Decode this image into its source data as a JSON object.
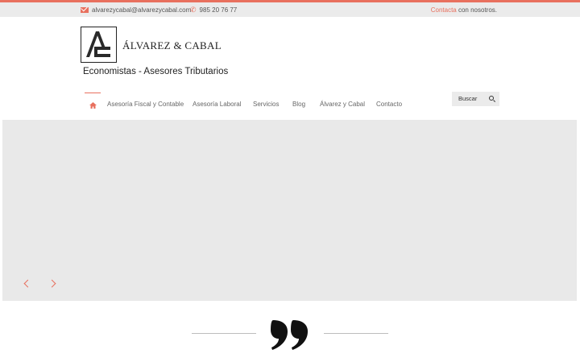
{
  "topbar": {
    "email": "alvarezycabal@alvarezycabal.com",
    "phone": "985 20 76 77",
    "contact_link": "Contacta",
    "contact_rest": " con nosotros."
  },
  "brand": {
    "name": "ÁLVAREZ & CABAL",
    "tagline": "Economistas - Asesores Tributarios"
  },
  "nav": {
    "items": [
      {
        "label": "Asesoría Fiscal y Contable"
      },
      {
        "label": "Asesoría Laboral"
      },
      {
        "label": "Servicios"
      },
      {
        "label": "Blog"
      },
      {
        "label": "Álvarez y Cabal"
      },
      {
        "label": "Contacto"
      }
    ]
  },
  "search": {
    "label": "Buscar"
  },
  "icons": {
    "home": "home-icon",
    "email": "envelope-icon",
    "phone": "phone-icon",
    "search": "search-icon",
    "prev": "chevron-left-icon",
    "next": "chevron-right-icon",
    "quote": "quote-icon"
  },
  "colors": {
    "accent": "#e8705e",
    "topbar_bg": "#ebebeb",
    "slider_bg": "#e9e9e9",
    "text_dark": "#222222"
  }
}
